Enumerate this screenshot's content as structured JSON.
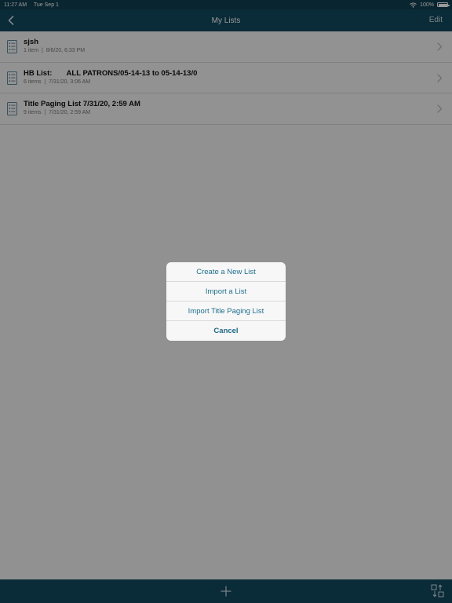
{
  "status": {
    "time": "11:27 AM",
    "date": "Tue Sep 1",
    "battery": "100%",
    "wifi_icon": "wifi-icon",
    "battery_level": 1.0
  },
  "nav": {
    "title": "My Lists",
    "edit_label": "Edit",
    "back_icon": "chevron-left-icon"
  },
  "lists": [
    {
      "title": "sjsh",
      "subtitle": "1 item  |  8/6/20, 6:33 PM"
    },
    {
      "title": "HB List:       ALL PATRONS/05-14-13 to 05-14-13/0",
      "subtitle": "6 items  |  7/31/20, 3:06 AM"
    },
    {
      "title": "Title Paging List 7/31/20, 2:59 AM",
      "subtitle": "9 items  |  7/31/20, 2:59 AM"
    }
  ],
  "action_sheet": {
    "items": [
      "Create a New List",
      "Import a List",
      "Import Title Paging List"
    ],
    "cancel_label": "Cancel"
  },
  "toolbar": {
    "add_icon": "plus-icon",
    "sort_icon": "sort-icon"
  },
  "colors": {
    "bar": "#12485e",
    "accent": "#1f6f8b"
  }
}
